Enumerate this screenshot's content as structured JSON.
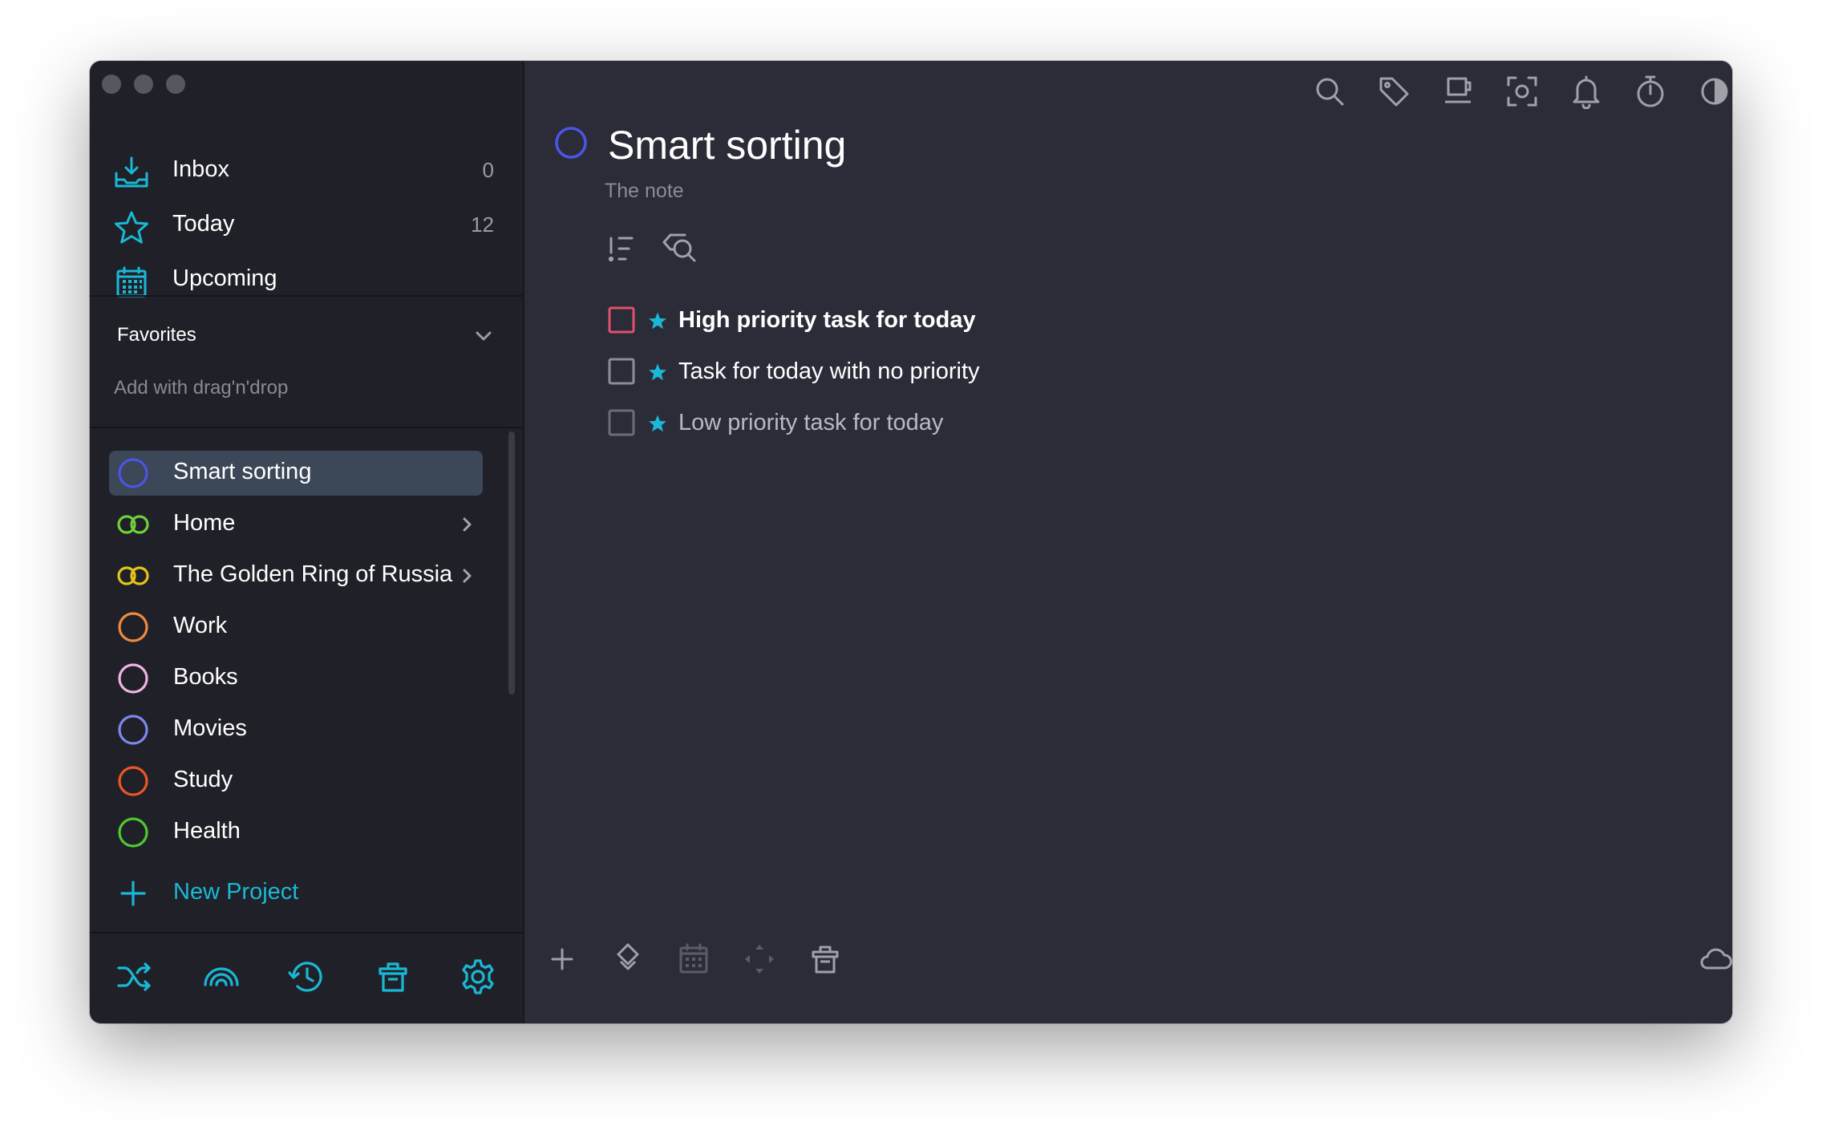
{
  "sidebar": {
    "nav": [
      {
        "label": "Inbox",
        "count": "0",
        "icon": "inbox-icon"
      },
      {
        "label": "Today",
        "count": "12",
        "icon": "star-icon"
      },
      {
        "label": "Upcoming",
        "count": "",
        "icon": "calendar-icon"
      }
    ],
    "favorites": {
      "title": "Favorites",
      "hint": "Add with drag'n'drop"
    },
    "projects": [
      {
        "label": "Smart sorting",
        "color": "#4a55e8",
        "selected": true
      },
      {
        "label": "Home",
        "color": "#6fd13a",
        "has_children": true
      },
      {
        "label": "The Golden Ring of Russia",
        "color": "#e3c51a",
        "has_children": true
      },
      {
        "label": "Work",
        "color": "#ee8a3e"
      },
      {
        "label": "Books",
        "color": "#f0b3e2"
      },
      {
        "label": "Movies",
        "color": "#7e87ef"
      },
      {
        "label": "Study",
        "color": "#ee5623"
      },
      {
        "label": "Health",
        "color": "#4fc933"
      }
    ],
    "new_project_label": "New Project",
    "bottom_buttons": [
      "shuffle-icon",
      "rainbow-icon",
      "history-icon",
      "trash-icon",
      "settings-icon"
    ]
  },
  "main": {
    "title": "Smart sorting",
    "note": "The note",
    "project_color": "#4a55e8",
    "toolbar": [
      "search-icon",
      "tag-icon",
      "mug-icon",
      "focus-icon",
      "bell-icon",
      "stopwatch-icon",
      "contrast-icon",
      "copy-icon"
    ],
    "tasks": [
      {
        "label": "High priority task for today",
        "priority": "high",
        "starred": true
      },
      {
        "label": "Task for today with no priority",
        "priority": "none",
        "starred": true
      },
      {
        "label": "Low priority task for today",
        "priority": "low",
        "starred": true
      }
    ],
    "bottom_buttons": [
      "add-icon",
      "layers-icon",
      "calendar-icon",
      "move-icon",
      "trash-icon",
      "cloud-icon"
    ]
  },
  "colors": {
    "accent": "#1ab8d6",
    "sidebar_bg": "#202128",
    "main_bg": "#2b2c38",
    "selected_bg": "#3c4758",
    "high_priority": "#e0516c"
  }
}
